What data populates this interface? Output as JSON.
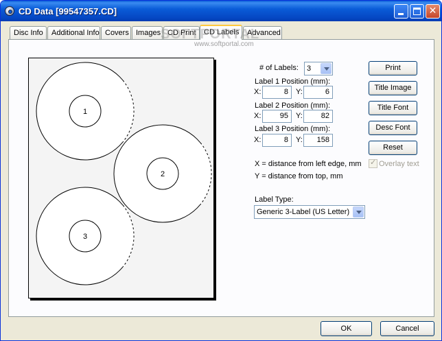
{
  "window": {
    "title": "CD Data [99547357.CD]"
  },
  "tabs": [
    {
      "label": "Disc Info"
    },
    {
      "label": "Additional Info"
    },
    {
      "label": "Covers"
    },
    {
      "label": "Images"
    },
    {
      "label": "CD Print"
    },
    {
      "label": "CD Labels"
    },
    {
      "label": "Advanced"
    }
  ],
  "active_tab": "CD Labels",
  "watermark": {
    "brand": "SOFTPORTAL",
    "url": "www.softportal.com"
  },
  "preview": {
    "labels": [
      {
        "text": "1"
      },
      {
        "text": "2"
      },
      {
        "text": "3"
      }
    ]
  },
  "settings": {
    "num_labels_label": "# of Labels:",
    "num_labels_value": "3",
    "label1_heading": "Label 1 Position (mm):",
    "label1_x": "8",
    "label1_y": "6",
    "label2_heading": "Label 2 Position (mm):",
    "label2_x": "95",
    "label2_y": "82",
    "label3_heading": "Label 3 Position (mm):",
    "label3_x": "8",
    "label3_y": "158",
    "x_label": "X:",
    "y_label": "Y:",
    "help_x": "X = distance from left edge, mm",
    "help_y": "Y = distance from top, mm",
    "label_type_label": "Label Type:",
    "label_type_value": "Generic 3-Label (US Letter)"
  },
  "actions": {
    "print": "Print",
    "title_image": "Title Image",
    "title_font": "Title Font",
    "desc_font": "Desc Font",
    "reset": "Reset",
    "overlay_text": "Overlay text",
    "overlay_checked": true
  },
  "dialog": {
    "ok": "OK",
    "cancel": "Cancel"
  }
}
